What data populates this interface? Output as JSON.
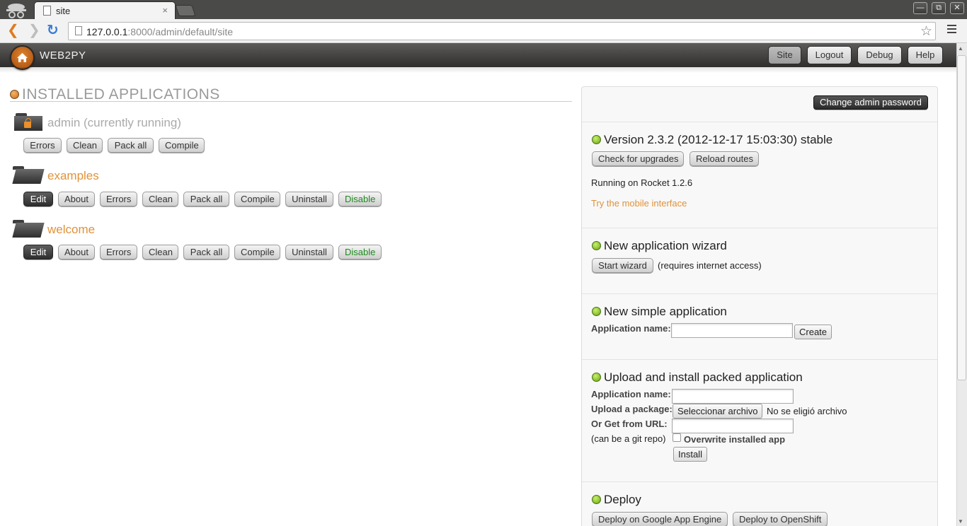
{
  "browser": {
    "tab_title": "site",
    "tab_close": "×",
    "url_host": "127.0.0.1",
    "url_path": ":8000/admin/default/site",
    "window_buttons": [
      "—",
      "⧉",
      "✕"
    ]
  },
  "header": {
    "logo_text": "WEB2PY",
    "nav": [
      "Site",
      "Logout",
      "Debug",
      "Help"
    ]
  },
  "installed": {
    "title": "INSTALLED APPLICATIONS",
    "apps": [
      {
        "name": "admin (currently running)",
        "buttons": [
          "Errors",
          "Clean",
          "Pack all",
          "Compile"
        ]
      },
      {
        "name": "examples",
        "buttons": [
          "Edit",
          "About",
          "Errors",
          "Clean",
          "Pack all",
          "Compile",
          "Uninstall",
          "Disable"
        ]
      },
      {
        "name": "welcome",
        "buttons": [
          "Edit",
          "About",
          "Errors",
          "Clean",
          "Pack all",
          "Compile",
          "Uninstall",
          "Disable"
        ]
      }
    ]
  },
  "panel": {
    "change_password": "Change admin password",
    "version": {
      "title": "Version 2.3.2 (2012-12-17 15:03:30) stable",
      "buttons": [
        "Check for upgrades",
        "Reload routes"
      ],
      "running": "Running on Rocket 1.2.6",
      "mobile_link": "Try the mobile interface"
    },
    "wizard": {
      "title": "New application wizard",
      "button": "Start wizard",
      "note": "(requires internet access)"
    },
    "simple": {
      "title": "New simple application",
      "label": "Application name:",
      "button": "Create"
    },
    "upload": {
      "title": "Upload and install packed application",
      "app_name_label": "Application name:",
      "package_label": "Upload a package:",
      "file_button": "Seleccionar archivo",
      "file_status": "No se eligió archivo",
      "url_label": "Or Get from URL:",
      "git_note": "(can be a git repo)",
      "overwrite_label": "Overwrite installed app",
      "install_button": "Install"
    },
    "deploy": {
      "title": "Deploy",
      "buttons": [
        "Deploy on Google App Engine",
        "Deploy to OpenShift"
      ]
    }
  }
}
